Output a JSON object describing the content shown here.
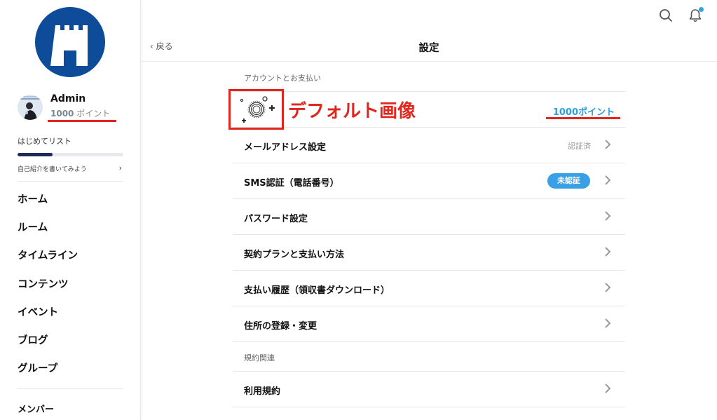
{
  "sidebar": {
    "username": "Admin",
    "points_number": "1000",
    "points_unit": "ポイント",
    "checklist_title": "はじめてリスト",
    "checklist_progress_percent": 33,
    "intro_prompt": "自己紹介を書いてみよう",
    "nav": [
      "ホーム",
      "ルーム",
      "タイムライン",
      "コンテンツ",
      "イベント",
      "ブログ",
      "グループ"
    ],
    "members_label": "メンバー"
  },
  "header": {
    "back_label": "戻る",
    "title": "設定"
  },
  "settings": {
    "account_section_label": "アカウントとお支払い",
    "points_value": "1000ポイント",
    "rows": [
      {
        "label": "メールアドレス設定",
        "status": "認証済"
      },
      {
        "label": "SMS認証（電話番号）",
        "badge": "未認証"
      },
      {
        "label": "パスワード設定"
      },
      {
        "label": "契約プランと支払い方法"
      },
      {
        "label": "支払い履歴（領収書ダウンロード）"
      },
      {
        "label": "住所の登録・変更"
      }
    ],
    "terms_section_label": "規約関連",
    "terms_rows": [
      {
        "label": "利用規約"
      }
    ]
  },
  "annotation": {
    "text": "デフォルト画像"
  },
  "colors": {
    "logo_blue": "#0e4c9a",
    "accent_blue": "#2a9fe0",
    "badge_blue": "#3aa0e6",
    "annotation_red": "#e0261f",
    "progress_navy": "#1f2a5a"
  },
  "icons": [
    "castle-logo",
    "search-icon",
    "bell-icon",
    "chevron-left-icon",
    "chevron-right-icon",
    "default-image-icon"
  ]
}
